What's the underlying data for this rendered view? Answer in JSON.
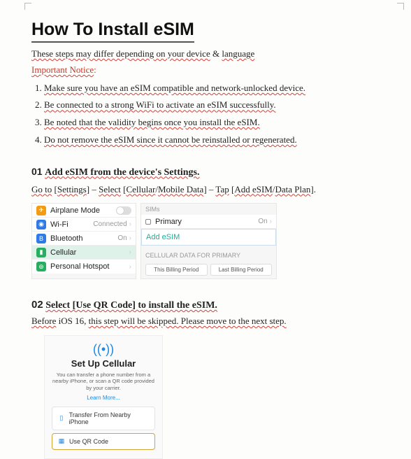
{
  "title": "How To Install eSIM",
  "subtitle_parts": {
    "a": "These steps may differ depending on your device",
    "amp": " & ",
    "b": "language"
  },
  "important_label": "Important Notice",
  "colon": ":",
  "notices": [
    "Make sure you have an eSIM compatible and network-unlocked device.",
    "Be connected to a strong WiFi to activate an eSIM successfully.",
    "Be noted that the validity begins once you install the eSIM.",
    "Do not remove the eSIM since it cannot be reinstalled or regenerated."
  ],
  "step1": {
    "num": "01",
    "title": "Add eSIM from the device's Settings.",
    "sub_parts": [
      "Go to",
      " [",
      "Settings",
      "] – ",
      "Select",
      " [",
      "Cellular",
      "/",
      "Mobile Data",
      "] – ",
      "Tap",
      " [",
      "Add eSIM",
      "/",
      "Data Plan",
      "]."
    ]
  },
  "ios_left": {
    "rows": [
      {
        "icon": "plane",
        "label": "Airplane Mode",
        "right": ""
      },
      {
        "icon": "wifi",
        "label": "Wi-Fi",
        "right": "Connected"
      },
      {
        "icon": "bt",
        "label": "Bluetooth",
        "right": "On"
      },
      {
        "icon": "cell",
        "label": "Cellular",
        "right": ""
      },
      {
        "icon": "hot",
        "label": "Personal Hotspot",
        "right": ""
      }
    ]
  },
  "ios_right": {
    "sims_hdr": "SIMs",
    "primary": "Primary",
    "primary_right": "On",
    "add": "Add eSIM",
    "cell_hdr": "CELLULAR DATA FOR PRIMARY",
    "pill1": "This Billing Period",
    "pill2": "Last Billing Period"
  },
  "step2": {
    "num": "02",
    "title": "Select [Use QR Code] to install the eSIM.",
    "sub_parts": [
      "Before",
      " iOS 16, ",
      "this step will be skipped. Please move to the next step."
    ]
  },
  "setup": {
    "title": "Set Up Cellular",
    "sub": "You can transfer a phone number from a nearby iPhone, or scan a QR code provided by your carrier.",
    "learn": "Learn More...",
    "opt1": "Transfer From Nearby iPhone",
    "opt2": "Use QR Code"
  }
}
